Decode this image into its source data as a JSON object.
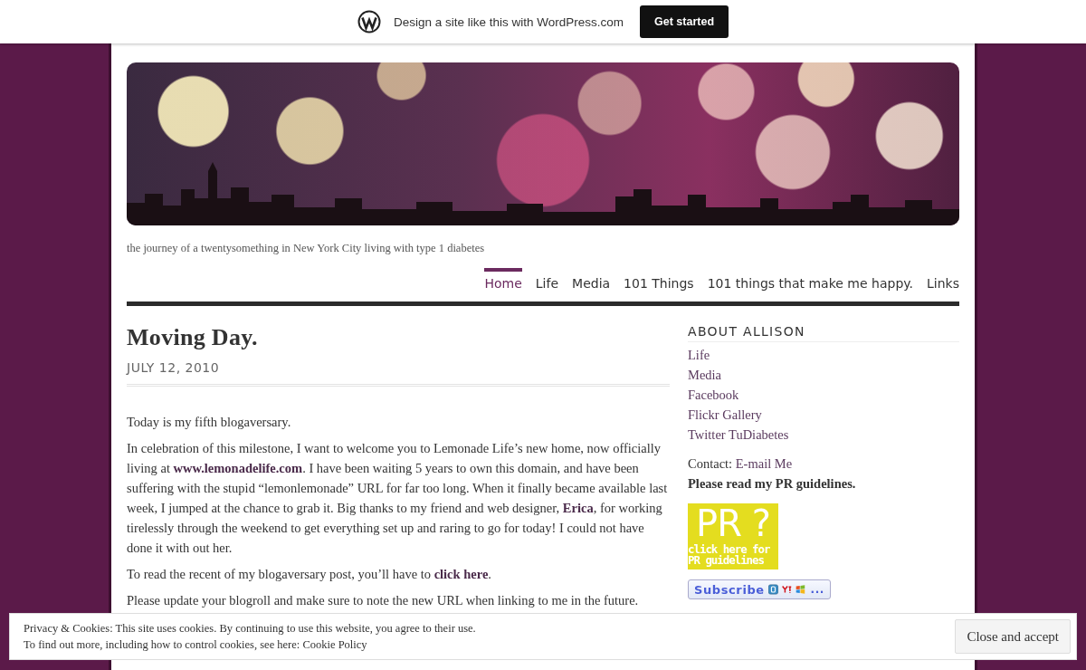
{
  "top_bar": {
    "text": "Design a site like this with WordPress.com",
    "button": "Get started"
  },
  "header": {
    "tagline": "the journey of a twentysomething in New York City living with type 1 diabetes"
  },
  "nav": [
    {
      "label": "Home",
      "selected": true
    },
    {
      "label": "Life",
      "selected": false
    },
    {
      "label": "Media",
      "selected": false
    },
    {
      "label": "101 Things",
      "selected": false
    },
    {
      "label": "101 things that make me happy.",
      "selected": false
    },
    {
      "label": "Links",
      "selected": false
    }
  ],
  "post": {
    "title": "Moving Day.",
    "date": "JULY 12, 2010",
    "paragraphs": [
      "Today is my fifth blogaversary.",
      "In celebration of this milestone, I want to welcome you to Lemonade Life’s new home, now officially living at **www.lemonadelife.com**. I have been waiting 5 years to own this domain, and have been suffering with the stupid “lemonlemonade” URL for far too long. When it finally became available last week, I jumped at the chance to grab it. Big thanks to my friend and web designer, **Erica**, for working tirelessly through the weekend to get everything set up and raring to go for today! I could not have done it with out her.",
      "To read the recent of my blogaversary post, you’ll have to **click here**.",
      "Please update your blogroll and make sure to note the new URL when linking to me in the future."
    ]
  },
  "sidebar": {
    "heading": "ABOUT ALLISON",
    "links": [
      "Life",
      "Media",
      "Facebook",
      "Flickr Gallery",
      "Twitter TuDiabetes"
    ],
    "contact": {
      "label": "Contact:",
      "link": "E-mail Me"
    },
    "pr_note": "Please read my PR guidelines.",
    "pr_badge": {
      "big": "PR ?",
      "lines": [
        "click here for",
        "PR guidelines"
      ]
    },
    "subscribe": {
      "label": "Subscribe",
      "more": "..."
    }
  },
  "cookie_banner": {
    "line1": "Privacy & Cookies: This site uses cookies. By continuing to use this website, you agree to their use.",
    "line2": "To find out more, including how to control cookies, see here:",
    "link": "Cookie Policy",
    "button": "Close and accept"
  }
}
